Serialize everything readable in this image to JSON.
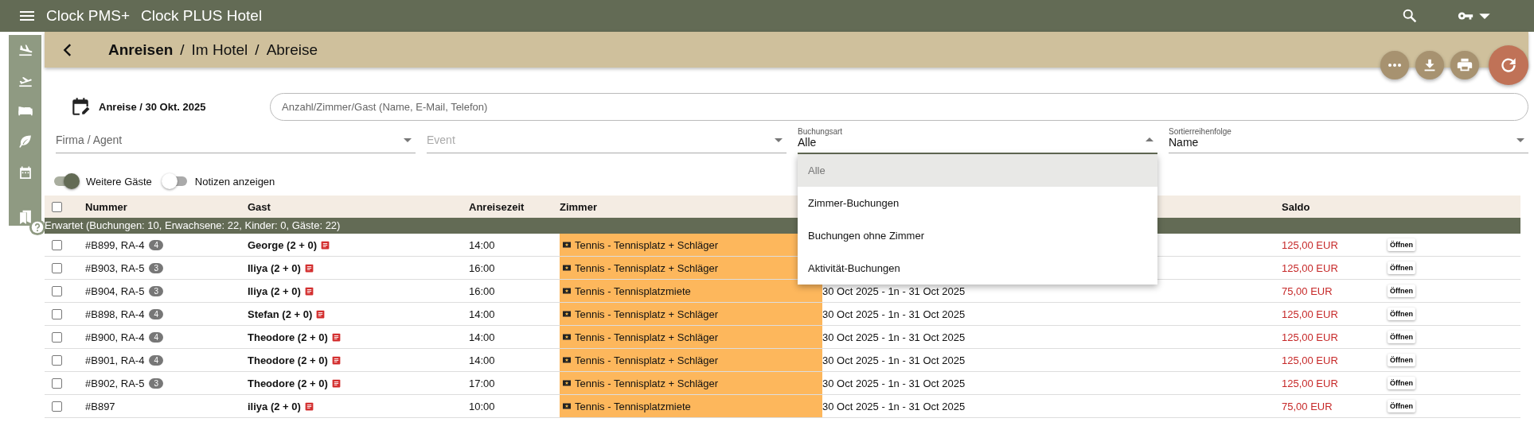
{
  "app_bar": {
    "title": "Clock PMS+",
    "hotel": "Clock PLUS Hotel"
  },
  "breadcrumb": {
    "separator": "/",
    "items": [
      {
        "label": "Anreisen",
        "selected": true
      },
      {
        "label": "Im Hotel",
        "selected": false
      },
      {
        "label": "Abreise",
        "selected": false
      }
    ]
  },
  "date_label": "Anreise / 30 Okt. 2025",
  "search": {
    "placeholder": "Anzahl/Zimmer/Gast (Name, E-Mail, Telefon)"
  },
  "filters": [
    {
      "label": "Firma / Agent",
      "disabled": false,
      "expanded": false
    },
    {
      "label": "Event",
      "disabled": true,
      "expanded": false
    },
    {
      "label": "Buchungsart",
      "value": "Alle",
      "disabled": false,
      "expanded": true,
      "options": [
        {
          "label": "Alle",
          "selected": true
        },
        {
          "label": "Zimmer-Buchungen",
          "selected": false
        },
        {
          "label": "Buchungen ohne Zimmer",
          "selected": false
        },
        {
          "label": "Aktivität-Buchungen",
          "selected": false
        }
      ]
    },
    {
      "label": "Sortierreihenfolge",
      "value": "Name",
      "disabled": false,
      "expanded": false
    }
  ],
  "toggles": [
    {
      "label": "Weitere Gäste",
      "on": true
    },
    {
      "label": "Notizen anzeigen",
      "on": false
    }
  ],
  "table": {
    "select_all": {
      "checked": false
    },
    "columns": [
      {
        "kind": "number",
        "label": "Nummer"
      },
      {
        "kind": "guest",
        "label": "Gast"
      },
      {
        "kind": "time",
        "label": "Anreisezeit"
      },
      {
        "kind": "room",
        "label": "Zimmer"
      },
      {
        "kind": "stay"
      },
      {
        "kind": "balance",
        "label": "Saldo"
      },
      {
        "kind": "action"
      }
    ],
    "group": "Erwartet (Buchungen: 10, Erwachsene: 22, Kinder: 0, Gäste: 22)",
    "rows": [
      {
        "checked": false,
        "number": "#B899, RA-4",
        "badge": "4",
        "guest": "George (2 + 0)",
        "time": "14:00",
        "room": "Tennis - Tennisplatz + Schläger",
        "balance": "125,00 EUR",
        "action": "Öffnen"
      },
      {
        "checked": false,
        "number": "#B903, RA-5",
        "badge": "3",
        "guest": "Iliya (2 + 0)",
        "time": "16:00",
        "room": "Tennis - Tennisplatz + Schläger",
        "balance": "125,00 EUR",
        "action": "Öffnen"
      },
      {
        "checked": false,
        "number": "#B904, RA-5",
        "badge": "3",
        "guest": "Iliya (2 + 0)",
        "time": "16:00",
        "room": "Tennis - Tennisplatzmiete",
        "stay": "30 Oct 2025 - 1n - 31 Oct 2025",
        "balance": "75,00 EUR",
        "action": "Öffnen"
      },
      {
        "checked": false,
        "number": "#B898, RA-4",
        "badge": "4",
        "guest": "Stefan (2 + 0)",
        "time": "14:00",
        "room": "Tennis - Tennisplatz + Schläger",
        "stay": "30 Oct 2025 - 1n - 31 Oct 2025",
        "balance": "125,00 EUR",
        "action": "Öffnen"
      },
      {
        "checked": false,
        "number": "#B900, RA-4",
        "badge": "4",
        "guest": "Theodore (2 + 0)",
        "time": "14:00",
        "room": "Tennis - Tennisplatz + Schläger",
        "stay": "30 Oct 2025 - 1n - 31 Oct 2025",
        "balance": "125,00 EUR",
        "action": "Öffnen"
      },
      {
        "checked": false,
        "number": "#B901, RA-4",
        "badge": "4",
        "guest": "Theodore (2 + 0)",
        "time": "14:00",
        "room": "Tennis - Tennisplatz + Schläger",
        "stay": "30 Oct 2025 - 1n - 31 Oct 2025",
        "balance": "125,00 EUR",
        "action": "Öffnen"
      },
      {
        "checked": false,
        "number": "#B902, RA-5",
        "badge": "3",
        "guest": "Theodore (2 + 0)",
        "time": "17:00",
        "room": "Tennis - Tennisplatz + Schläger",
        "stay": "30 Oct 2025 - 1n - 31 Oct 2025",
        "balance": "125,00 EUR",
        "action": "Öffnen"
      },
      {
        "checked": false,
        "number": "#B897",
        "guest": "iliya (2 + 0)",
        "time": "10:00",
        "room": "Tennis - Tennisplatzmiete",
        "stay": "30 Oct 2025 - 1n - 31 Oct 2025",
        "balance": "75,00 EUR",
        "action": "Öffnen"
      }
    ]
  }
}
